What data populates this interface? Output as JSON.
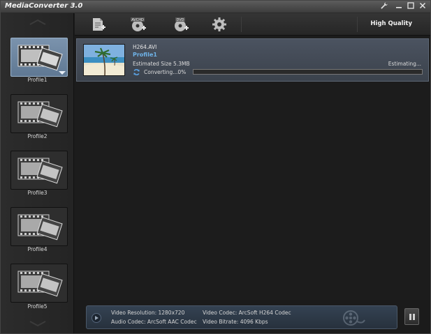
{
  "app": {
    "title": "MediaConverter 3.0"
  },
  "titlebar_buttons": [
    {
      "name": "settings-wrench",
      "glyph": "⚒"
    },
    {
      "name": "minimize",
      "glyph": "–"
    },
    {
      "name": "maximize",
      "glyph": "□"
    },
    {
      "name": "close",
      "glyph": "✕"
    }
  ],
  "toolbar": {
    "quality_label": "High Quality",
    "buttons": [
      {
        "name": "add-files-button",
        "icon": "add-file-icon"
      },
      {
        "name": "add-avchd-button",
        "icon": "add-avchd-icon",
        "badge": "AVCHD"
      },
      {
        "name": "add-dvd-button",
        "icon": "add-dvd-icon",
        "badge": "DVD"
      },
      {
        "name": "settings-button",
        "icon": "gear-icon"
      }
    ]
  },
  "sidebar": {
    "profiles": [
      {
        "label": "Profile1",
        "selected": true
      },
      {
        "label": "Profile2",
        "selected": false
      },
      {
        "label": "Profile3",
        "selected": false
      },
      {
        "label": "Profile4",
        "selected": false
      },
      {
        "label": "Profile5",
        "selected": false
      }
    ]
  },
  "task": {
    "file_name": "H264.AVI",
    "profile": "Profile1",
    "estimated_size": "Estimated Size 5.3MB",
    "estimating": "Estimating...",
    "status": "Converting...0%",
    "progress": 0
  },
  "info": {
    "video_resolution": "Video Resolution: 1280x720",
    "audio_codec": "Audio Codec: ArcSoft AAC Codec",
    "video_codec": "Video Codec: ArcSoft H264 Codec",
    "video_bitrate": "Video Bitrate: 4096 Kbps"
  },
  "colors": {
    "accent_blue": "#6fb3e8",
    "selected_profile": "#6f88a2",
    "progress_fill": "#5a8fc0"
  }
}
